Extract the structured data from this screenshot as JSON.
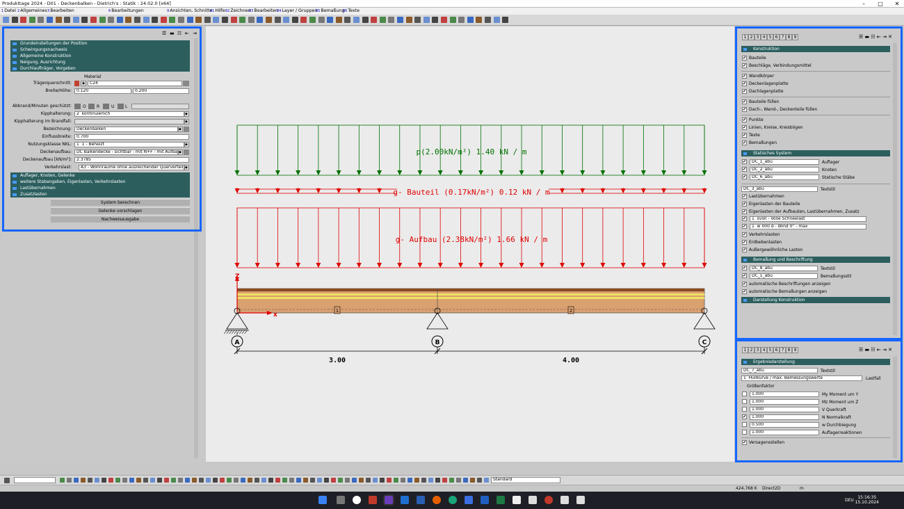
{
  "window": {
    "title": "Produkttage 2024 - D01 - Deckenbalken - Dietrich's : Statik : 24.02.0 [x64]",
    "min": "–",
    "max": "□",
    "close": "✕"
  },
  "menu": [
    {
      "num": "1",
      "label": "Datei"
    },
    {
      "num": "2",
      "label": "Allgemeines"
    },
    {
      "num": "3",
      "label": "Bearbeiten"
    },
    {
      "num": "6",
      "label": "Bearbeitungen"
    },
    {
      "num": "9",
      "label": "Ansichten, Schnitte"
    },
    {
      "num": "61",
      "label": "Hilfe"
    },
    {
      "num": "82",
      "label": "Zeichnen"
    },
    {
      "num": "83",
      "label": "Bearbeiten"
    },
    {
      "num": "84",
      "label": "Layer / Gruppen"
    },
    {
      "num": "85",
      "label": "Bemaßung"
    },
    {
      "num": "86",
      "label": "Texte"
    }
  ],
  "left_panel": {
    "sections_top": [
      "Grundeinstellungen der Position",
      "Schwingungsnachweis",
      "Allgemeine Konstruktion",
      "Neigung, Ausrichtung",
      "Durchlaufträger, Vorgaben"
    ],
    "material_heading": "Material",
    "traegerquerschnitt_label": "Trägerquerschnitt:",
    "traegerquerschnitt_value": "C24",
    "breite_hoehe_label": "Breite/Höhe:",
    "breite": "0.120",
    "hoehe": "0.200",
    "abbrand_label": "Abbrand/Minuten geschützt:",
    "abbrand_o": "O",
    "abbrand_r": "R",
    "abbrand_u": "U",
    "abbrand_l": "L",
    "kipphalterung_label": "Kipphalterung:",
    "kipphalterung_num": "2",
    "kipphalterung_value": "kontinuierlich",
    "kipphalterung_brand_label": "Kipphalterung im Brandfall:",
    "bezeichnung_label": "Bezeichnung:",
    "bezeichnung_value": "Deckenbalken",
    "einflussbreite_label": "Einflussbreite:",
    "einflussbreite_value": "0.700",
    "nutzungsklasse_label": "Nutzungsklasse NKL:",
    "nutzungsklasse_num": "1",
    "nutzungsklasse_value": "1 - Beheizt",
    "deckenaufbau_label": "Deckenaufbau:",
    "deckenaufbau_value": "DC Balkendecke - sichtbar - mit N+F - mit Aufbau",
    "deckenaufbau_kn_label": "Deckenaufbau [kN/m²]:",
    "deckenaufbau_kn_value": "2.3785",
    "verkehrslast_label": "Verkehrslast:",
    "verkehrslast_value": "A3 - Wohnräume ohne ausreichender Querverteilung",
    "sections_bottom": [
      "Auflager, Knoten, Gelenke",
      "weitere Stabangaben, Eigenlasten, Verkehrslasten",
      "Lastübernahmen",
      "Zusatzlasten"
    ],
    "buttons": [
      "System berechnen",
      "Gelenke vorschlagen",
      "Nachweisausgabe"
    ]
  },
  "drawing": {
    "load_p": "p(2.00kN/m²) 1.40 kN / m",
    "load_g_bauteil": "g- Bauteil (0.17kN/m²) 0.12 kN / m",
    "load_g_aufbau": "g- Aufbau (2.38kN/m²) 1.66 kN / m",
    "axis_z": "Z",
    "axis_x": "x",
    "support_a": "A",
    "support_b": "B",
    "support_c": "C",
    "member_1": "1",
    "member_2": "2",
    "span_1": "3.00",
    "span_2": "4.00",
    "colors": {
      "p": "#007000",
      "g": "#e00000",
      "beam": "#d9a070"
    }
  },
  "right_top": {
    "tabs": [
      "1",
      "2",
      "3",
      "4",
      "5",
      "6",
      "7",
      "8",
      "9"
    ],
    "konstruktion": "Konstruktion",
    "items1": [
      "Bauteile",
      "Beschläge, Verbindungsmittel"
    ],
    "items2": [
      "Wandkörper",
      "Deckenlagenplatte",
      "Dachlagenplatte"
    ],
    "items3": [
      "Bauteile füllen",
      "Dach-, Wand-, Deckenteile füllen"
    ],
    "items4": [
      "Punkte",
      "Linien, Kreise, Kreisbögen",
      "Texte",
      "Bemaßungen"
    ],
    "statisches_system": "Statisches System",
    "dc1": "DC_1_abu",
    "dc1_lbl": "Auflager",
    "dc2": "DC_2_abu",
    "dc2_lbl": "Knoten",
    "dc6": "DC_6_abu",
    "dc6_lbl": "Statische Stäbe",
    "dc3": "DC_3_abu",
    "dc3_lbl": "Textstil",
    "items5": [
      "Lastübernahmen",
      "Eigenlasten der Bauteile",
      "Eigenlasten der Aufbauten, Lastübernahmen, Zusatz"
    ],
    "snow_num": "1",
    "snow": "svoll - Volle Schneelast",
    "wind_num": "1",
    "wind": "w 000 d - Wind 0° - max",
    "items6": [
      "Verkehrslasten",
      "Erdbebenlasten",
      "Außergewöhnliche Lasten"
    ],
    "bemassung": "Bemaßung und Beschriftung",
    "dc8": "DC_8_abu",
    "dc8_lbl": "Textstil",
    "dc1b": "DC_1_abu",
    "dc1b_lbl": "Bemaßungsstil",
    "items7": [
      "automatische Beschriftungen anzeigen",
      "automatische Bemaßungen anzeigen"
    ],
    "darstellung": "Darstellung Konstruktion"
  },
  "right_bottom": {
    "tabs": [
      "1",
      "2",
      "3",
      "4",
      "5",
      "6",
      "7",
      "8",
      "9"
    ],
    "ergebnis": "Ergebnisdarstellung",
    "dc7": "DC_7_abu",
    "dc7_lbl": "Textstil",
    "lastfall_num": "1",
    "lastfall": "Hüllkurve / max. Bemessungswerte",
    "lastfall_lbl": "Lastfall",
    "groessen": "Größenfaktor",
    "factors": [
      {
        "v": "1.000",
        "l": "My Moment um Y",
        "c": false
      },
      {
        "v": "1.000",
        "l": "Mz Moment um Z",
        "c": false
      },
      {
        "v": "1.000",
        "l": "V Querkraft",
        "c": false
      },
      {
        "v": "1.000",
        "l": "N Normalkraft",
        "c": true
      },
      {
        "v": "0.500",
        "l": "w Durchbiegung",
        "c": false
      },
      {
        "v": "1.000",
        "l": "Auflagerreaktionen",
        "c": false
      }
    ],
    "versagen": "Versagensstellen"
  },
  "bottom": {
    "style": "Standard"
  },
  "status": {
    "coord": "424.768 K",
    "mode": "Direct2D",
    "unit": "m"
  },
  "clock": {
    "time": "15:16:35",
    "date": "15.10.2024",
    "lang": "DEU"
  }
}
